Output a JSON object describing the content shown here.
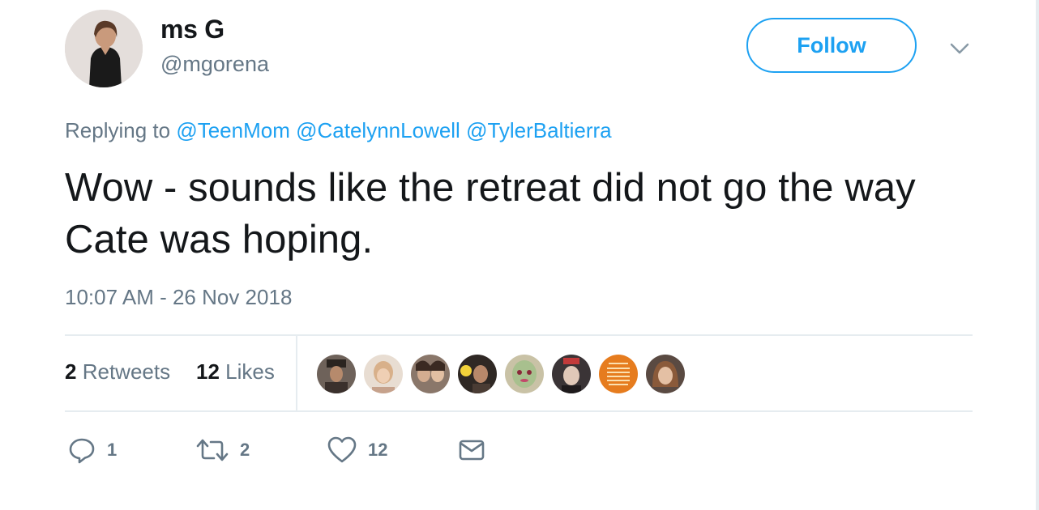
{
  "user": {
    "display_name": "ms G",
    "handle": "@mgorena",
    "follow_label": "Follow"
  },
  "reply": {
    "prefix": "Replying to",
    "mentions": [
      "@TeenMom",
      "@CatelynnLowell",
      "@TylerBaltierra"
    ]
  },
  "tweet": {
    "text": "Wow - sounds like the retreat did not go the way Cate was hoping.",
    "timestamp": "10:07 AM - 26 Nov 2018"
  },
  "stats": {
    "retweets_count": "2",
    "retweets_label": "Retweets",
    "likes_count": "12",
    "likes_label": "Likes"
  },
  "likers": [
    {
      "name": "liker-1",
      "color": "#4a403a"
    },
    {
      "name": "liker-2",
      "color": "#caa98a"
    },
    {
      "name": "liker-3",
      "color": "#6d5548"
    },
    {
      "name": "liker-4",
      "color": "#3b2f29"
    },
    {
      "name": "liker-5",
      "color": "#9fb58a"
    },
    {
      "name": "liker-6",
      "color": "#2e2a2c"
    },
    {
      "name": "liker-7",
      "color": "#e07a22"
    },
    {
      "name": "liker-8",
      "color": "#7a5a4a"
    }
  ],
  "actions": {
    "reply_count": "1",
    "retweet_count": "2",
    "like_count": "12"
  },
  "colors": {
    "accent": "#1da1f2",
    "muted": "#657786",
    "text": "#14171a",
    "divider": "#e6ecf0"
  },
  "icons": {
    "reply": "reply-icon",
    "retweet": "retweet-icon",
    "like": "heart-icon",
    "dm": "envelope-icon",
    "more": "chevron-down-icon"
  }
}
